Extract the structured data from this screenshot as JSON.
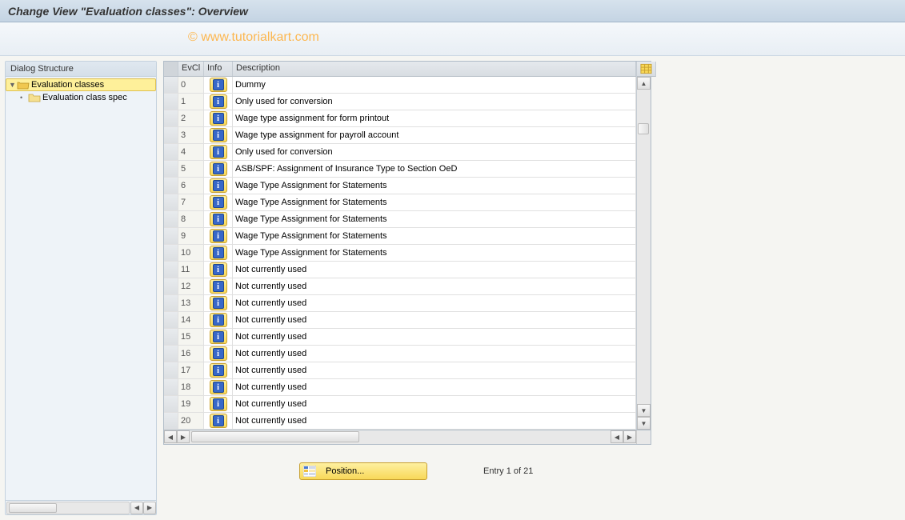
{
  "title": "Change View \"Evaluation classes\": Overview",
  "watermark": "© www.tutorialkart.com",
  "sidebar": {
    "header": "Dialog Structure",
    "items": [
      {
        "label": "Evaluation classes",
        "level": 0,
        "open": true,
        "selected": true,
        "expand": "▼"
      },
      {
        "label": "Evaluation class spec",
        "level": 1,
        "open": false,
        "selected": false,
        "expand": "•"
      }
    ]
  },
  "table": {
    "headers": {
      "evcl": "EvCl",
      "info": "Info",
      "desc": "Description"
    },
    "rows": [
      {
        "evcl": "0",
        "desc": "Dummy"
      },
      {
        "evcl": "1",
        "desc": "Only used for conversion"
      },
      {
        "evcl": "2",
        "desc": "Wage type assignment for form printout"
      },
      {
        "evcl": "3",
        "desc": "Wage type assignment for payroll account"
      },
      {
        "evcl": "4",
        "desc": "Only used for conversion"
      },
      {
        "evcl": "5",
        "desc": "ASB/SPF: Assignment of Insurance Type to Section OeD"
      },
      {
        "evcl": "6",
        "desc": "Wage Type Assignment for Statements"
      },
      {
        "evcl": "7",
        "desc": "Wage Type Assignment for Statements"
      },
      {
        "evcl": "8",
        "desc": "Wage Type Assignment for Statements"
      },
      {
        "evcl": "9",
        "desc": "Wage Type Assignment for Statements"
      },
      {
        "evcl": "10",
        "desc": "Wage Type Assignment for Statements"
      },
      {
        "evcl": "11",
        "desc": "Not currently used"
      },
      {
        "evcl": "12",
        "desc": "Not currently used"
      },
      {
        "evcl": "13",
        "desc": "Not currently used"
      },
      {
        "evcl": "14",
        "desc": "Not currently used"
      },
      {
        "evcl": "15",
        "desc": "Not currently used"
      },
      {
        "evcl": "16",
        "desc": "Not currently used"
      },
      {
        "evcl": "17",
        "desc": "Not currently used"
      },
      {
        "evcl": "18",
        "desc": "Not currently used"
      },
      {
        "evcl": "19",
        "desc": "Not currently used"
      },
      {
        "evcl": "20",
        "desc": "Not currently used"
      }
    ]
  },
  "footer": {
    "position_label": "Position...",
    "entry_info": "Entry 1 of 21"
  }
}
